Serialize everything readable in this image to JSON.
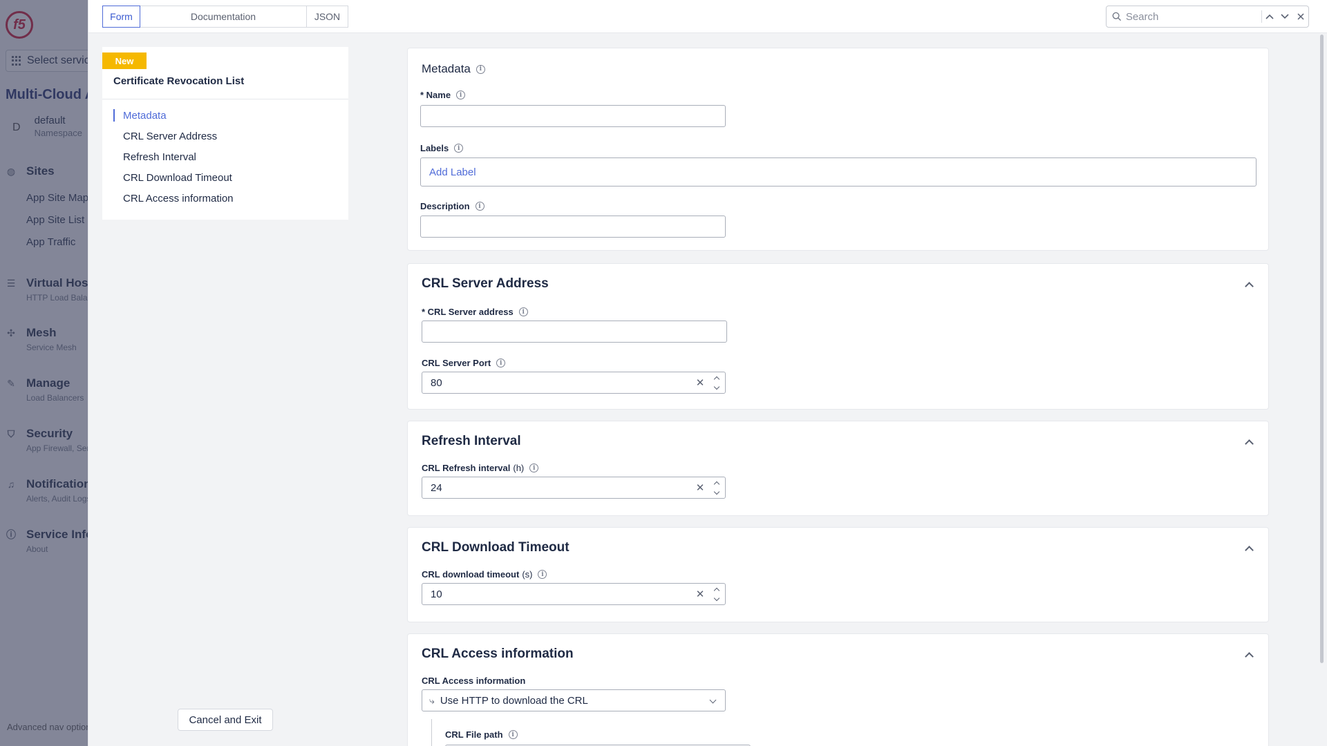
{
  "leftnav": {
    "service_select": "Select service",
    "app_title": "Multi-Cloud App Connect",
    "namespace": {
      "initial": "D",
      "name": "default",
      "label": "Namespace"
    },
    "groups": [
      {
        "title": "Sites",
        "icon": "globe-icon",
        "sub": ""
      },
      {
        "title": "Virtual Hosts",
        "icon": "layers-icon",
        "sub": "HTTP Load Balancers"
      },
      {
        "title": "Mesh",
        "icon": "mesh-icon",
        "sub": "Service Mesh"
      },
      {
        "title": "Manage",
        "icon": "wrench-icon",
        "sub": "Load Balancers"
      },
      {
        "title": "Security",
        "icon": "shield-icon",
        "sub": "App Firewall, Service Policies"
      },
      {
        "title": "Notifications",
        "icon": "bell-icon",
        "sub": "Alerts, Audit Logs"
      },
      {
        "title": "Service Info",
        "icon": "info-icon",
        "sub": "About"
      }
    ],
    "site_items": [
      "App Site Map",
      "App Site List",
      "App Traffic"
    ],
    "advanced": "Advanced nav options"
  },
  "topbar": {
    "tabs": [
      "Form",
      "Documentation",
      "JSON"
    ],
    "search_placeholder": "Search"
  },
  "secnav": {
    "badge": "New",
    "title": "Certificate Revocation List",
    "items": [
      "Metadata",
      "CRL Server Address",
      "Refresh Interval",
      "CRL Download Timeout",
      "CRL Access information"
    ]
  },
  "cancel_label": "Cancel and Exit",
  "metadata": {
    "title": "Metadata",
    "name_label": "* Name",
    "labels_label": "Labels",
    "add_label": "Add Label",
    "description_label": "Description"
  },
  "crl_server": {
    "title": "CRL Server Address",
    "address_label": "* CRL Server address",
    "port_label": "CRL Server Port",
    "port_value": "80"
  },
  "refresh": {
    "title": "Refresh Interval",
    "label": "CRL Refresh interval",
    "unit": "(h)",
    "value": "24"
  },
  "timeout": {
    "title": "CRL Download Timeout",
    "label": "CRL download timeout",
    "unit": "(s)",
    "value": "10"
  },
  "access": {
    "title": "CRL Access information",
    "label": "CRL Access information",
    "selected": "Use HTTP to download the CRL",
    "file_path_label": "CRL File path"
  },
  "colors": {
    "accent": "#4f6bd8",
    "badge": "#f5b800",
    "brand": "#c8102e"
  }
}
